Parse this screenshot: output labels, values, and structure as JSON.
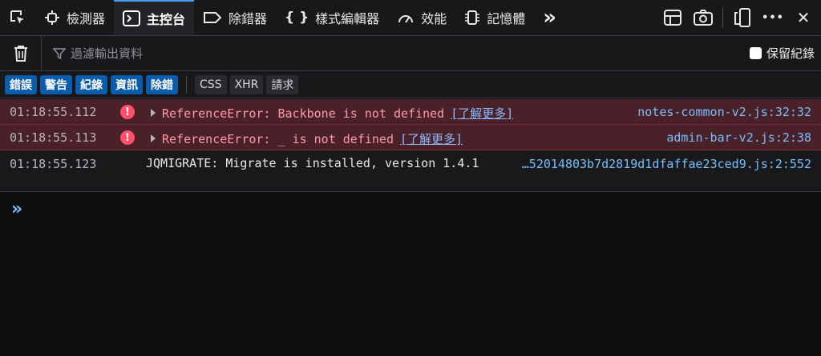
{
  "toolbar": {
    "tabs": [
      {
        "label": "檢測器",
        "icon": "inspector-icon"
      },
      {
        "label": "主控台",
        "icon": "console-icon"
      },
      {
        "label": "除錯器",
        "icon": "debugger-icon"
      },
      {
        "label": "樣式編輯器",
        "icon": "style-editor-icon"
      },
      {
        "label": "效能",
        "icon": "performance-icon"
      },
      {
        "label": "記憶體",
        "icon": "memory-icon"
      }
    ],
    "more_label": "»",
    "close_label": "✕",
    "meatball_label": "•••"
  },
  "filter": {
    "placeholder": "過濾輸出資料",
    "persist_label": "保留紀錄"
  },
  "categories": {
    "errors": "錯誤",
    "warnings": "警告",
    "logs": "紀錄",
    "info": "資訊",
    "debug": "除錯",
    "css": "CSS",
    "xhr": "XHR",
    "requests": "請求"
  },
  "messages": [
    {
      "time": "01:18:55.112",
      "text": "ReferenceError: Backbone is not defined",
      "learn": "[了解更多]",
      "source": "notes-common-v2.js:32:32"
    },
    {
      "time": "01:18:55.113",
      "text": "ReferenceError: _ is not defined",
      "learn": "[了解更多]",
      "source": "admin-bar-v2.js:2:38"
    },
    {
      "time": "01:18:55.123",
      "text": "JQMIGRATE: Migrate is installed, version 1.4.1",
      "source": "…52014803b7d2819d1dfaffae23ced9.js:2:552"
    }
  ],
  "prompt_symbol": "»",
  "colors": {
    "accent": "#0b5cab",
    "error_bg": "#4b2129",
    "link": "#75bfff"
  }
}
